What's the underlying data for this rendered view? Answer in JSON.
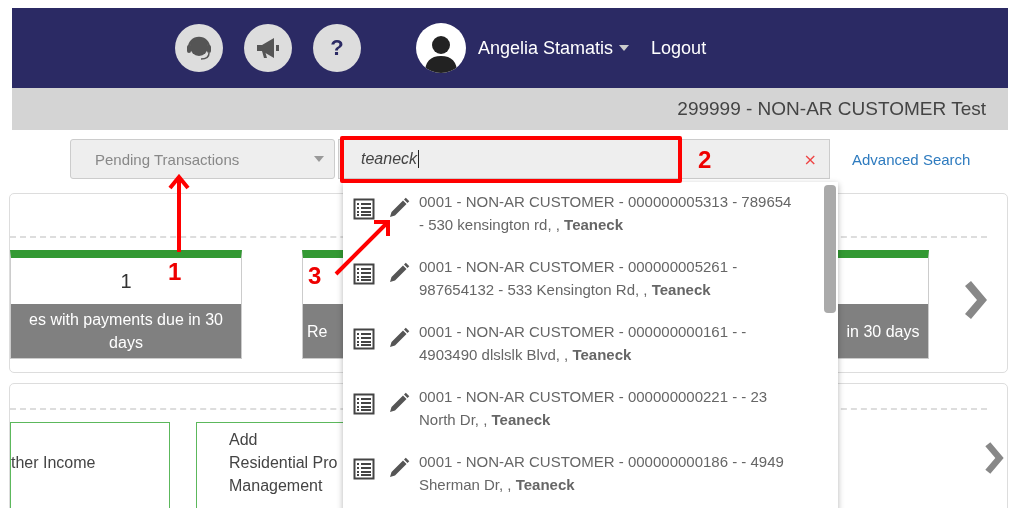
{
  "header": {
    "icons": [
      {
        "kind": "headset"
      },
      {
        "kind": "megaphone"
      },
      {
        "kind": "help",
        "label": "?"
      }
    ],
    "user": {
      "name": "Angelia Stamatis"
    },
    "logout": "Logout"
  },
  "customer_bar": {
    "title": "299999 - NON-AR CUSTOMER Test"
  },
  "filter": {
    "placeholder": "Pending Transactions"
  },
  "search": {
    "value": "teaneck",
    "clear": "×"
  },
  "advanced_search": "Advanced Search",
  "panels": [
    {
      "cards": [
        {
          "kind": "stat",
          "count": "1",
          "label": "es with payments due in 30 days"
        },
        {
          "kind": "stat",
          "label": "Re"
        },
        {
          "kind": "stat",
          "label": "in 30 days"
        }
      ]
    },
    {
      "cards": [
        {
          "kind": "action",
          "lines": [
            "ther Income"
          ]
        },
        {
          "kind": "action",
          "lines": [
            "Add",
            "Residential Pro",
            "Management"
          ]
        }
      ]
    }
  ],
  "results": [
    {
      "text": "0001 - NON-AR CUSTOMER - 000000005313 - 789654 - 530 kensington rd, , **Teaneck**"
    },
    {
      "text": "0001 - NON-AR CUSTOMER - 000000005261 - 987654132 - 533 Kensington Rd, , **Teaneck**"
    },
    {
      "text": "0001 - NON-AR CUSTOMER - 000000000161 - - 4903490 dlslslk Blvd, , **Teaneck**"
    },
    {
      "text": "0001 - NON-AR CUSTOMER - 000000000221 - - 23 North Dr, , **Teaneck**"
    },
    {
      "text": "0001 - NON-AR CUSTOMER - 000000000186 - - 4949 Sherman Dr, , **Teaneck**"
    }
  ],
  "annotations": [
    {
      "label": "1"
    },
    {
      "label": "2"
    },
    {
      "label": "3"
    }
  ]
}
